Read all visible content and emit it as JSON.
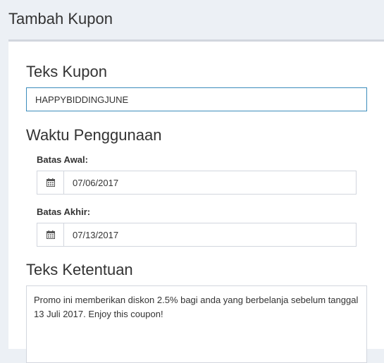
{
  "header": {
    "title": "Tambah Kupon"
  },
  "coupon": {
    "section_title": "Teks Kupon",
    "value": "HAPPYBIDDINGJUNE"
  },
  "usage": {
    "section_title": "Waktu Penggunaan",
    "start_label": "Batas Awal:",
    "start_value": "07/06/2017",
    "end_label": "Batas Akhir:",
    "end_value": "07/13/2017",
    "icon": "calendar-icon"
  },
  "terms": {
    "section_title": "Teks Ketentuan",
    "text": "Promo ini memberikan diskon 2.5% bagi anda yang berbelanja sebelum tanggal 13 Juli 2017. Enjoy this coupon!"
  },
  "colors": {
    "focus_border": "#3c8dbc",
    "border": "#d2d6de",
    "background": "#ecf0f5"
  }
}
